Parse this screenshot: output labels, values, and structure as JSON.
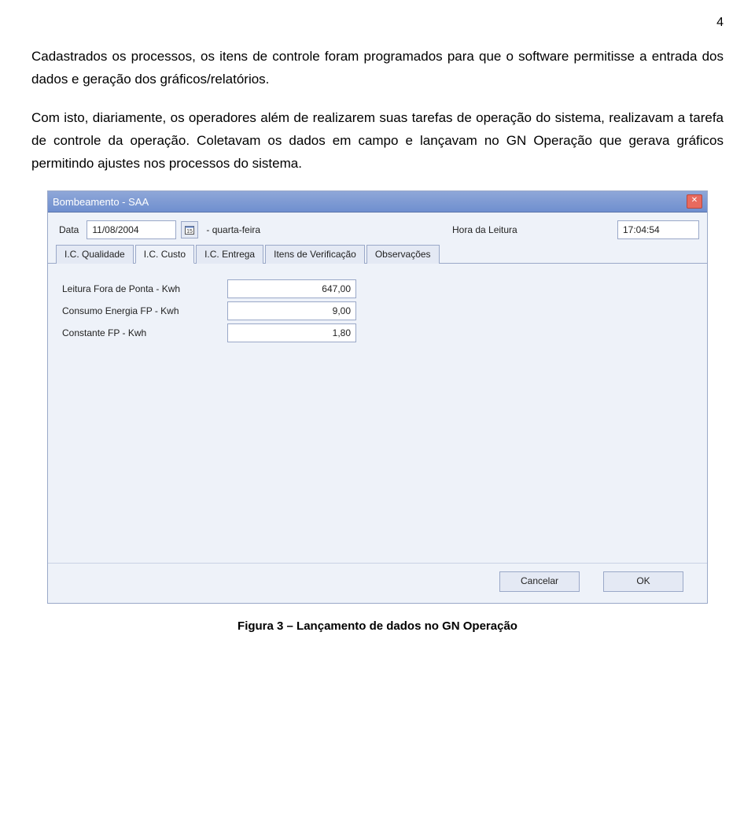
{
  "page": {
    "number": "4",
    "para1": "Cadastrados os processos, os itens de controle foram programados para que o software permitisse a entrada dos dados e geração dos gráficos/relatórios.",
    "para2": "Com isto, diariamente, os operadores além de realizarem suas tarefas de operação do sistema, realizavam a tarefa de controle da operação. Coletavam os dados em campo e lançavam no GN Operação que gerava gráficos permitindo ajustes nos processos do sistema.",
    "caption": "Figura 3 – Lançamento de dados no GN Operação"
  },
  "window": {
    "title": "Bombeamento  -  SAA",
    "toprow": {
      "data_label": "Data",
      "data_value": "11/08/2004",
      "weekday": "- quarta-feira",
      "hora_label": "Hora da Leitura",
      "hora_value": "17:04:54"
    },
    "tabs": [
      {
        "label": "I.C. Qualidade",
        "active": false
      },
      {
        "label": "I.C. Custo",
        "active": true
      },
      {
        "label": "I.C. Entrega",
        "active": false
      },
      {
        "label": "Itens de Verificação",
        "active": false
      },
      {
        "label": "Observações",
        "active": false
      }
    ],
    "fields": [
      {
        "label": "Leitura Fora de Ponta - Kwh",
        "value": "647,00"
      },
      {
        "label": "Consumo Energia  FP - Kwh",
        "value": "9,00"
      },
      {
        "label": "Constante FP - Kwh",
        "value": "1,80"
      }
    ],
    "buttons": {
      "cancel": "Cancelar",
      "ok": "OK"
    }
  }
}
